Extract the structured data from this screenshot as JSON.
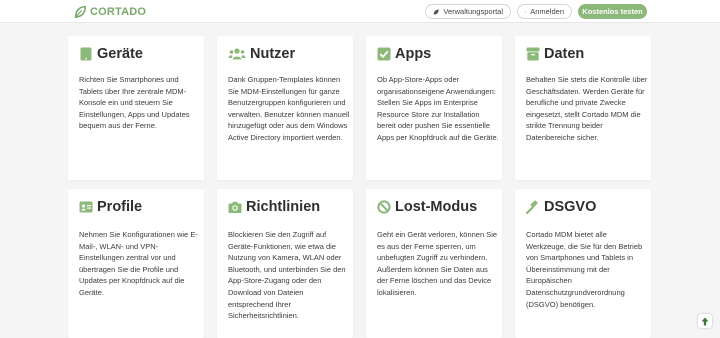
{
  "header": {
    "logo_text": "CORTADO",
    "portal_label": "Verwaltungsportal",
    "login_label": "Anmelden",
    "trial_label": "Kostenlos testen"
  },
  "colors": {
    "brand_green": "#7aa86a",
    "button_green": "#8cb879",
    "icon_green": "#8cb879"
  },
  "cards": [
    {
      "icon": "tablet-icon",
      "title": "Geräte",
      "text": "Richten Sie Smartphones und Tablets über Ihre zentrale MDM-Konsole ein und steuern Sie Einstellungen, Apps und Updates bequem aus der Ferne."
    },
    {
      "icon": "users-icon",
      "title": "Nutzer",
      "text": "Dank Gruppen-Templates können Sie MDM-Einstellungen für ganze Benutzergruppen konfigurieren und verwalten. Benutzer können manuell hinzugefügt oder aus dem Windows Active Directory importiert werden."
    },
    {
      "icon": "checkbox-icon",
      "title": "Apps",
      "text": "Ob App-Store-Apps oder organisationseigene Anwendungen: Stellen Sie Apps im Enterprise Resource Store zur Installation bereit oder pushen Sie essentielle Apps per Knopfdruck auf die Geräte."
    },
    {
      "icon": "archive-box-icon",
      "title": "Daten",
      "text": "Behalten Sie stets die Kontrolle über Geschäftsdaten. Werden Geräte für berufliche und private Zwecke eingesetzt, stellt Cortado MDM die strikte Trennung beider Datenbereiche sicher."
    },
    {
      "icon": "id-card-icon",
      "title": "Profile",
      "text": "Nehmen Sie Konfigurationen wie E-Mail-, WLAN- und VPN-Einstellungen zentral vor und übertragen Sie die Profile und Updates per Knopfdruck auf die Geräte."
    },
    {
      "icon": "camera-icon",
      "title": "Richtlinien",
      "text": "Blockieren Sie den Zugriff auf Geräte-Funktionen, wie etwa die Nutzung von Kamera, WLAN oder Bluetooth, und unterbinden Sie den App-Store-Zugang oder den Download von Dateien entsprechend Ihrer Sicherheitsrichtlinien."
    },
    {
      "icon": "ban-icon",
      "title": "Lost-Modus",
      "text": "Geht ein Gerät verloren, können Sie es aus der Ferne sperren, um unbefugten Zugriff zu verhindern. Außerdem können Sie Daten aus der Ferne löschen und das Device lokalisieren."
    },
    {
      "icon": "gavel-icon",
      "title": "DSGVO",
      "text": "Cortado MDM bietet alle Werkzeuge, die Sie für den Betrieb von Smartphones und Tablets in Übereinstimmung mit der Europäischen Datenschutzgrundverordnung (DSGVO) benötigen."
    }
  ]
}
